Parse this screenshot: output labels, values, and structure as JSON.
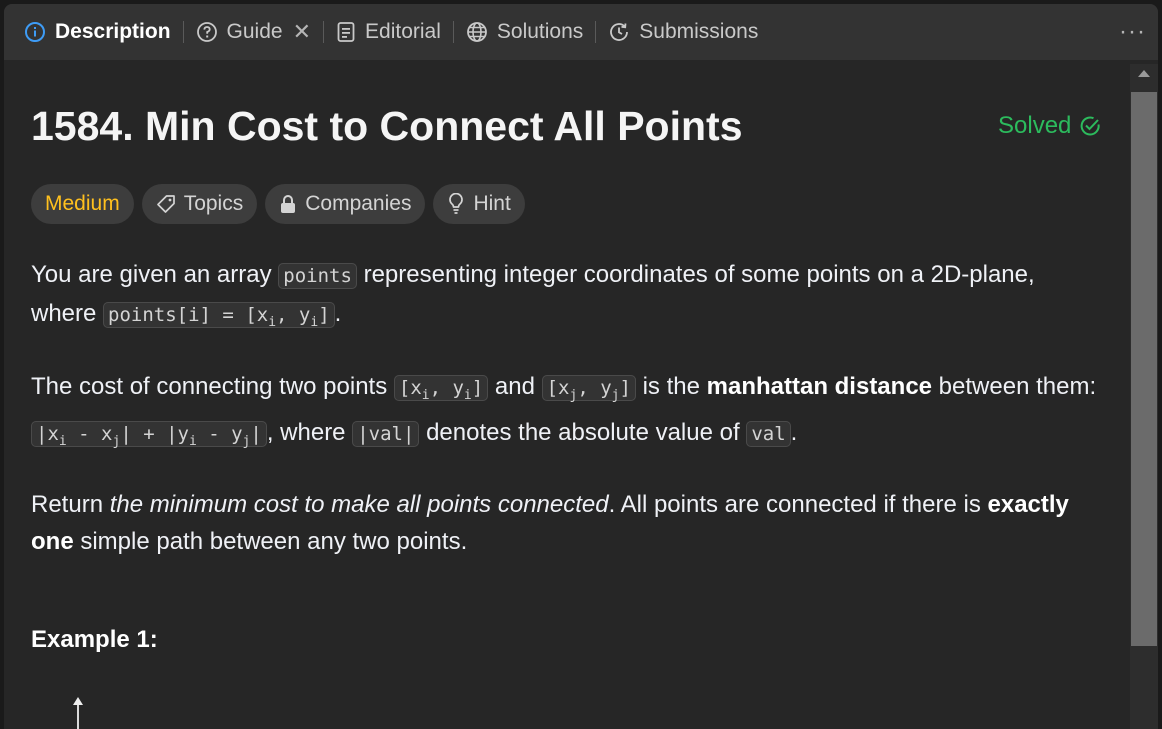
{
  "tabs": [
    {
      "label": "Description",
      "icon": "info-icon"
    },
    {
      "label": "Guide",
      "icon": "help-circle-icon"
    },
    {
      "label": "Editorial",
      "icon": "document-icon"
    },
    {
      "label": "Solutions",
      "icon": "globe-icon"
    },
    {
      "label": "Submissions",
      "icon": "history-icon"
    }
  ],
  "guide_close": "✕",
  "more": "···",
  "problem": {
    "title": "1584. Min Cost to Connect All Points",
    "status": "Solved"
  },
  "tags": {
    "difficulty": "Medium",
    "topics": "Topics",
    "companies": "Companies",
    "hint": "Hint"
  },
  "desc": {
    "p1_a": "You are given an array ",
    "p1_code1": "points",
    "p1_b": " representing integer coordinates of some points on a 2D-plane, where ",
    "p1_code2_a": "points[i] = [x",
    "p1_code2_sub1": "i",
    "p1_code2_b": ", y",
    "p1_code2_sub2": "i",
    "p1_code2_c": "]",
    "p1_end": ".",
    "p2_a": "The cost of connecting two points ",
    "p2_c1_a": "[x",
    "p2_c1_s1": "i",
    "p2_c1_b": ", y",
    "p2_c1_s2": "i",
    "p2_c1_c": "]",
    "p2_b": " and ",
    "p2_c2_a": "[x",
    "p2_c2_s1": "j",
    "p2_c2_b": ", y",
    "p2_c2_s2": "j",
    "p2_c2_c": "]",
    "p2_c": " is the ",
    "p2_bold": "manhattan distance",
    "p2_d": " between them: ",
    "p2_c3_a": "|x",
    "p2_c3_s1": "i",
    "p2_c3_b": " - x",
    "p2_c3_s2": "j",
    "p2_c3_c": "| + |y",
    "p2_c3_s3": "i",
    "p2_c3_d": " - y",
    "p2_c3_s4": "j",
    "p2_c3_e": "|",
    "p2_e": ", where ",
    "p2_c4": "|val|",
    "p2_f": " denotes the absolute value of ",
    "p2_c5": "val",
    "p2_g": ".",
    "p3_a": "Return ",
    "p3_italic": "the minimum cost to make all points connected",
    "p3_b": ". All points are connected if there is ",
    "p3_bold": "exactly one",
    "p3_c": " simple path between any two points."
  },
  "example_heading": "Example 1:"
}
